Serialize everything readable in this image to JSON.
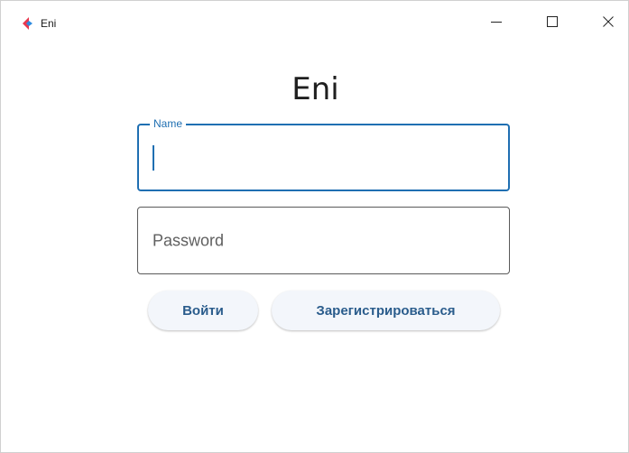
{
  "window": {
    "title": "Eni",
    "icon": "eni-app-icon",
    "controls": {
      "minimize_icon": "minimize-icon",
      "maximize_icon": "maximize-icon",
      "close_icon": "close-icon"
    }
  },
  "main": {
    "title": "Eni",
    "name_field": {
      "label": "Name",
      "value": ""
    },
    "password_field": {
      "placeholder": "Password",
      "value": ""
    },
    "login_button_label": "Войти",
    "register_button_label": "Зарегистрироваться"
  },
  "colors": {
    "accent": "#1f6fb2",
    "button_text": "#2a5c8c",
    "button_bg": "#f3f6fb",
    "icon_red": "#e8384f",
    "icon_blue": "#2f8be0"
  }
}
